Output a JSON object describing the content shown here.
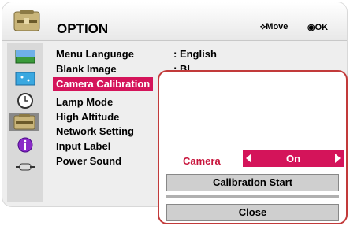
{
  "header": {
    "title": "OPTION",
    "move_hint": "Move",
    "ok_hint": "OK"
  },
  "sidebar": {
    "icons": [
      "picture-icon",
      "screen-icon",
      "clock-icon",
      "option-icon",
      "info-icon",
      "input-icon"
    ]
  },
  "menu": {
    "items": [
      {
        "label": "Menu Language",
        "value": ": English"
      },
      {
        "label": "Blank Image",
        "value": ": Bl"
      },
      {
        "label": "Camera Calibration"
      },
      {
        "label": "Lamp Mode"
      },
      {
        "label": "High Altitude"
      },
      {
        "label": "Network Setting"
      },
      {
        "label": "Input Label"
      },
      {
        "label": "Power Sound"
      }
    ]
  },
  "popup": {
    "camera_label": "Camera",
    "camera_value": "On",
    "calibration_button": "Calibration Start",
    "close_button": "Close"
  },
  "colors": {
    "accent": "#d4145a",
    "popup_border": "#c23a3a",
    "panel_bg": "#eeeeee"
  }
}
